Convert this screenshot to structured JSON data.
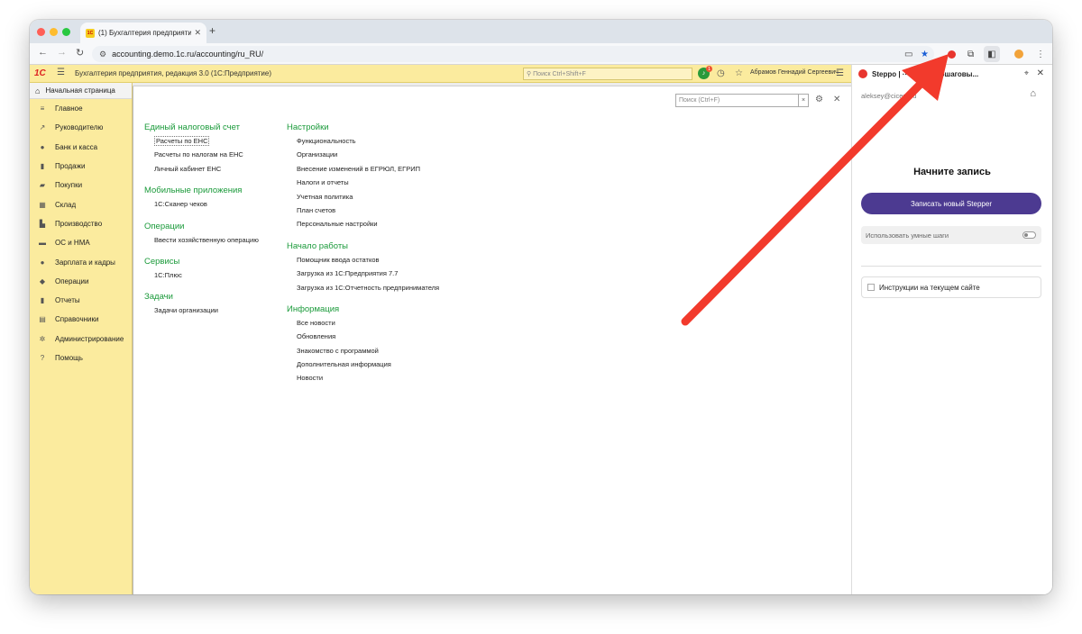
{
  "browser": {
    "tab_title": "(1) Бухгалтерия предприяти",
    "tab_favicon_text": "1С",
    "url": "accounting.demo.1c.ru/accounting/ru_RU/"
  },
  "onec": {
    "logo": "1С",
    "title": "Бухгалтерия предприятия, редакция 3.0  (1С:Предприятие)",
    "search_placeholder": "Поиск Ctrl+Shift+F",
    "notification_count": "1",
    "user": "Абрамов Геннадий Сергеевич"
  },
  "sidebar": {
    "home": "Начальная страница",
    "items": [
      {
        "label": "Главное",
        "icon": "≡"
      },
      {
        "label": "Руководителю",
        "icon": "↗"
      },
      {
        "label": "Банк и касса",
        "icon": "●"
      },
      {
        "label": "Продажи",
        "icon": "▮"
      },
      {
        "label": "Покупки",
        "icon": "▰"
      },
      {
        "label": "Склад",
        "icon": "▦"
      },
      {
        "label": "Производство",
        "icon": "▙"
      },
      {
        "label": "ОС и НМА",
        "icon": "▬"
      },
      {
        "label": "Зарплата и кадры",
        "icon": "●"
      },
      {
        "label": "Операции",
        "icon": "◆"
      },
      {
        "label": "Отчеты",
        "icon": "▮"
      },
      {
        "label": "Справочники",
        "icon": "▤"
      },
      {
        "label": "Администрирование",
        "icon": "✲"
      },
      {
        "label": "Помощь",
        "icon": "?"
      }
    ]
  },
  "main": {
    "search_placeholder": "Поиск (Ctrl+F)",
    "col1": [
      {
        "header": "Единый налоговый счет",
        "links": [
          "Расчеты по ЕНС",
          "Расчеты по налогам на ЕНС",
          "Личный кабинет ЕНС"
        ]
      },
      {
        "header": "Мобильные приложения",
        "links": [
          "1С:Сканер чеков"
        ]
      },
      {
        "header": "Операции",
        "links": [
          "Ввести хозяйственную операцию"
        ]
      },
      {
        "header": "Сервисы",
        "links": [
          "1С:Плюс"
        ]
      },
      {
        "header": "Задачи",
        "links": [
          "Задачи организации"
        ]
      }
    ],
    "col2": [
      {
        "header": "Настройки",
        "links": [
          "Функциональность",
          "Организации",
          "Внесение изменений в ЕГРЮЛ, ЕГРИП",
          "Налоги и отчеты",
          "Учетная политика",
          "План счетов",
          "Персональные настройки"
        ]
      },
      {
        "header": "Начало работы",
        "links": [
          "Помощник ввода остатков",
          "Загрузка из 1С:Предприятия 7.7",
          "Загрузка из 1С:Отчетность предпринимателя"
        ]
      },
      {
        "header": "Информация",
        "links": [
          "Все новости",
          "Обновления",
          "Знакомство с программой",
          "Дополнительная информация",
          "Новости"
        ]
      }
    ]
  },
  "steppo": {
    "title": "Steppo | ···ческие пошаговы...",
    "email": "aleksey@cicer...ru",
    "heading": "Начните запись",
    "record_button": "Записать новый Stepper",
    "smart_steps": "Использовать умные шаги",
    "instructions": "Инструкции на текущем сайте"
  },
  "colors": {
    "onec_yellow": "#fbeb9e",
    "section_green": "#1a9a3a",
    "steppo_purple": "#4c3a91",
    "arrow_red": "#f23a2c"
  }
}
